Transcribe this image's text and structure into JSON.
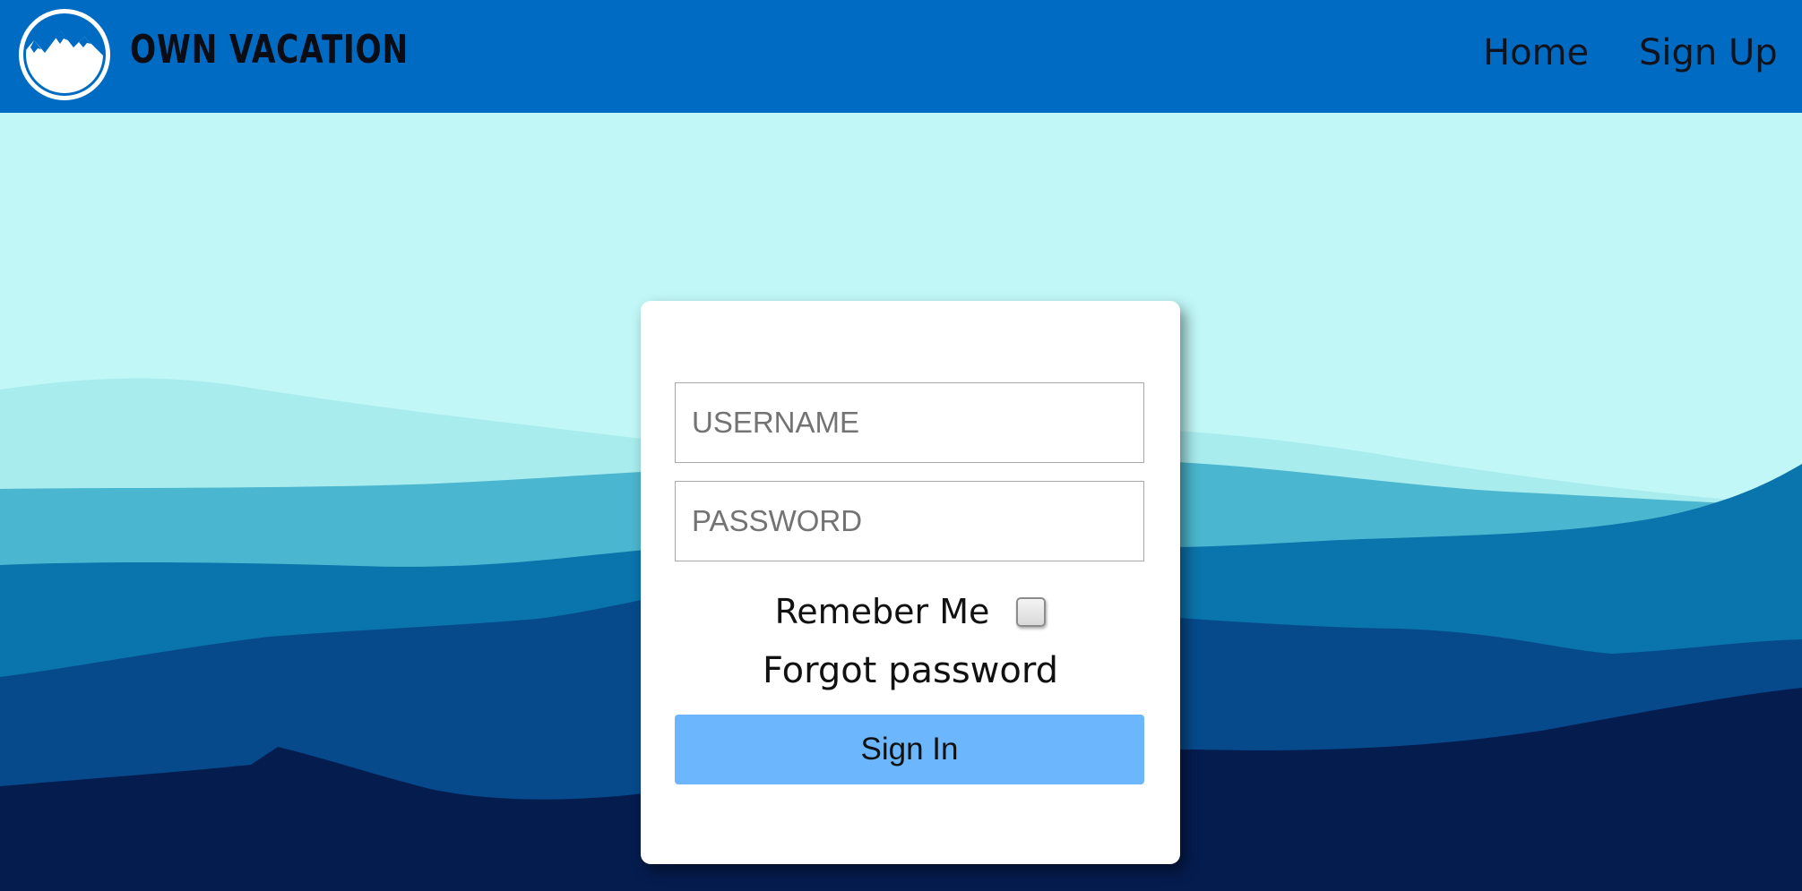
{
  "header": {
    "brand": "OWN VACATION",
    "logo_icon": "mountain-logo-icon",
    "nav": [
      {
        "label": "Home"
      },
      {
        "label": "Sign Up"
      }
    ],
    "background_color": "#006bc3"
  },
  "login": {
    "username_placeholder": "USERNAME",
    "password_placeholder": "PASSWORD",
    "remember_label": "Remeber Me",
    "remember_checked": false,
    "forgot_label": "Forgot password",
    "signin_label": "Sign In",
    "button_color": "#6bb6fd"
  },
  "background": {
    "sky_color": "#c1f7f7",
    "mountain_colors": [
      "#a8ecee",
      "#4bb6cf",
      "#0a74ac",
      "#064a8c",
      "#051c4f"
    ]
  }
}
